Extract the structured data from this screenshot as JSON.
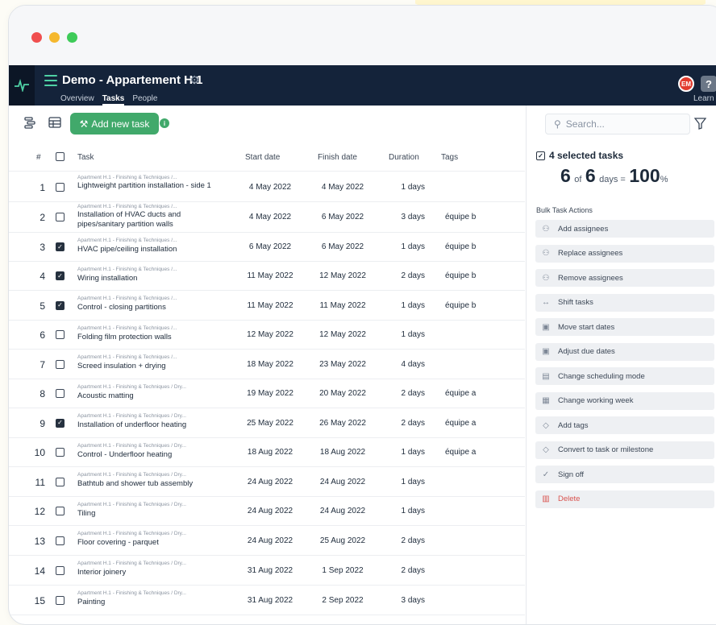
{
  "window": {
    "dot_colors": [
      "#f04f4f",
      "#f5b82e",
      "#3ecb59"
    ]
  },
  "header": {
    "project_title": "Demo - Appartement H.1",
    "tabs": [
      {
        "label": "Overview",
        "active": false
      },
      {
        "label": "Tasks",
        "active": true
      },
      {
        "label": "People",
        "active": false
      }
    ],
    "avatar_initials": "EM",
    "help_icon_label": "?",
    "learn_label": "Learn"
  },
  "toolbar": {
    "add_task_label": "Add new task",
    "info_label": "i",
    "search_placeholder": "Search...",
    "icons": [
      "list-view-icon",
      "table-view-icon",
      "filter-icon"
    ]
  },
  "table": {
    "headers": {
      "num": "#",
      "task": "Task",
      "start": "Start date",
      "finish": "Finish date",
      "duration": "Duration",
      "tags": "Tags"
    },
    "rows": [
      {
        "num": "1",
        "checked": false,
        "path": "Apartment H.1 - Finishing & Techniques /...",
        "name": "Lightweight partition installation - side 1",
        "start": "4 May 2022",
        "finish": "4 May 2022",
        "duration": "1 days",
        "tag": ""
      },
      {
        "num": "2",
        "checked": false,
        "path": "Apartment H.1 - Finishing & Techniques /...",
        "name": "Installation of HVAC ducts and pipes/sanitary partition walls",
        "start": "4 May 2022",
        "finish": "6 May 2022",
        "duration": "3 days",
        "tag": "équipe b"
      },
      {
        "num": "3",
        "checked": true,
        "path": "Apartment H.1 - Finishing & Techniques /...",
        "name": "HVAC pipe/ceiling installation",
        "start": "6 May 2022",
        "finish": "6 May 2022",
        "duration": "1 days",
        "tag": "équipe b"
      },
      {
        "num": "4",
        "checked": true,
        "path": "Apartment H.1 - Finishing & Techniques /...",
        "name": "Wiring installation",
        "start": "11 May 2022",
        "finish": "12 May 2022",
        "duration": "2 days",
        "tag": "équipe b"
      },
      {
        "num": "5",
        "checked": true,
        "path": "Apartment H.1 - Finishing & Techniques /...",
        "name": "Control - closing partitions",
        "start": "11 May 2022",
        "finish": "11 May 2022",
        "duration": "1 days",
        "tag": "équipe b"
      },
      {
        "num": "6",
        "checked": false,
        "path": "Apartment H.1 - Finishing & Techniques /...",
        "name": "Folding film protection walls",
        "start": "12 May 2022",
        "finish": "12 May 2022",
        "duration": "1 days",
        "tag": ""
      },
      {
        "num": "7",
        "checked": false,
        "path": "Apartment H.1 - Finishing & Techniques /...",
        "name": "Screed insulation + drying",
        "start": "18 May 2022",
        "finish": "23 May 2022",
        "duration": "4 days",
        "tag": ""
      },
      {
        "num": "8",
        "checked": false,
        "path": "Apartment H.1 - Finishing & Techniques / Dry...",
        "name": "Acoustic matting",
        "start": "19 May 2022",
        "finish": "20 May 2022",
        "duration": "2 days",
        "tag": "équipe a"
      },
      {
        "num": "9",
        "checked": true,
        "path": "Apartment H.1 - Finishing & Techniques / Dry...",
        "name": "Installation of underfloor heating",
        "start": "25 May 2022",
        "finish": "26 May 2022",
        "duration": "2 days",
        "tag": "équipe a"
      },
      {
        "num": "10",
        "checked": false,
        "path": "Apartment H.1 - Finishing & Techniques / Dry...",
        "name": "Control - Underfloor heating",
        "start": "18 Aug 2022",
        "finish": "18 Aug 2022",
        "duration": "1 days",
        "tag": "équipe a"
      },
      {
        "num": "11",
        "checked": false,
        "path": "Apartment H.1 - Finishing & Techniques / Dry...",
        "name": "Bathtub and shower tub assembly",
        "start": "24 Aug 2022",
        "finish": "24 Aug 2022",
        "duration": "1 days",
        "tag": ""
      },
      {
        "num": "12",
        "checked": false,
        "path": "Apartment H.1 - Finishing & Techniques / Dry...",
        "name": "Tiling",
        "start": "24 Aug 2022",
        "finish": "24 Aug 2022",
        "duration": "1 days",
        "tag": ""
      },
      {
        "num": "13",
        "checked": false,
        "path": "Apartment H.1 - Finishing & Techniques / Dry...",
        "name": "Floor covering - parquet",
        "start": "24 Aug 2022",
        "finish": "25 Aug 2022",
        "duration": "2 days",
        "tag": ""
      },
      {
        "num": "14",
        "checked": false,
        "path": "Apartment H.1 - Finishing & Techniques / Dry...",
        "name": "Interior joinery",
        "start": "31 Aug 2022",
        "finish": "1 Sep 2022",
        "duration": "2 days",
        "tag": ""
      },
      {
        "num": "15",
        "checked": false,
        "path": "Apartment H.1 - Finishing & Techniques / Dry...",
        "name": "Painting",
        "start": "31 Aug 2022",
        "finish": "2 Sep 2022",
        "duration": "3 days",
        "tag": ""
      }
    ]
  },
  "panel": {
    "selected_label": "4 selected tasks",
    "ratio_done": "6",
    "ratio_of": "of",
    "ratio_total": "6",
    "ratio_unit": "days =",
    "ratio_percent": "100",
    "ratio_percent_sign": "%",
    "bulk_title": "Bulk Task Actions",
    "actions": [
      {
        "label": "Add assignees",
        "icon": "add-assignee-icon",
        "glyph": "⚇"
      },
      {
        "label": "Replace assignees",
        "icon": "replace-assignees-icon",
        "glyph": "⚇"
      },
      {
        "label": "Remove assignees",
        "icon": "remove-assignee-icon",
        "glyph": "⚇"
      },
      {
        "label": "Shift tasks",
        "icon": "shift-icon",
        "glyph": "↔"
      },
      {
        "label": "Move start dates",
        "icon": "calendar-move-icon",
        "glyph": "▣"
      },
      {
        "label": "Adjust due dates",
        "icon": "calendar-adjust-icon",
        "glyph": "▣"
      },
      {
        "label": "Change scheduling mode",
        "icon": "scheduling-icon",
        "glyph": "▤"
      },
      {
        "label": "Change working week",
        "icon": "calendar-week-icon",
        "glyph": "▦"
      },
      {
        "label": "Add tags",
        "icon": "tag-icon",
        "glyph": "◇"
      },
      {
        "label": "Convert to task or milestone",
        "icon": "milestone-icon",
        "glyph": "◇"
      },
      {
        "label": "Sign off",
        "icon": "thumbs-up-icon",
        "glyph": "✓"
      },
      {
        "label": "Delete",
        "icon": "trash-icon",
        "glyph": "▥",
        "danger": true
      }
    ]
  }
}
